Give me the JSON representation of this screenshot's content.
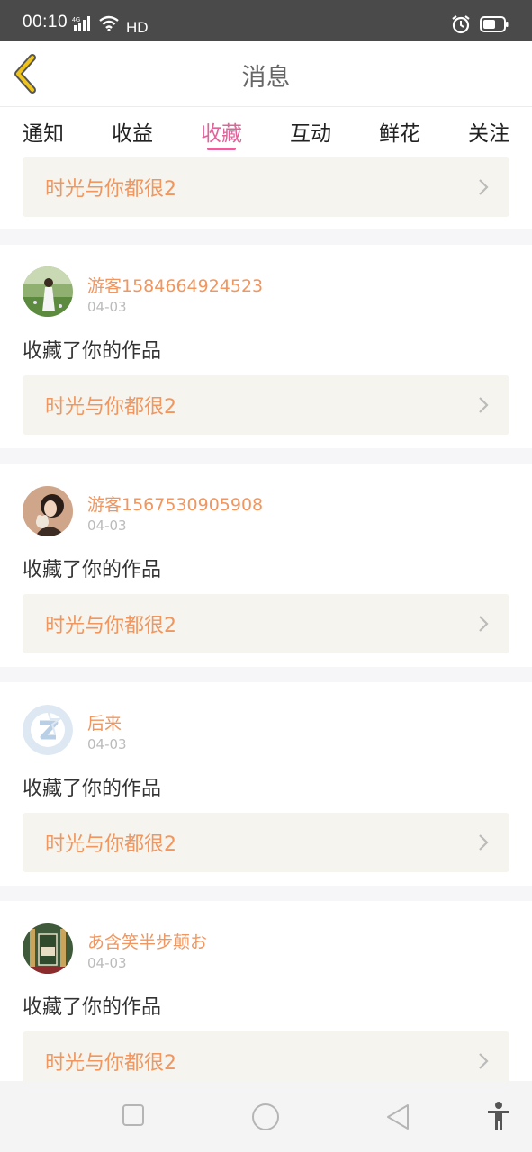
{
  "status": {
    "time": "00:10",
    "network": "4G",
    "hd": "HD",
    "bar_color": "#4a4a4a"
  },
  "header": {
    "title": "消息",
    "back_icon": "chevron-left-icon",
    "back_color": "#f0c419"
  },
  "tabs": [
    {
      "label": "通知",
      "active": false
    },
    {
      "label": "收益",
      "active": false
    },
    {
      "label": "收藏",
      "active": true
    },
    {
      "label": "互动",
      "active": false
    },
    {
      "label": "鲜花",
      "active": false
    },
    {
      "label": "关注",
      "active": false
    }
  ],
  "colors": {
    "accent_pink": "#e0649a",
    "accent_orange": "#f0965e",
    "link_bg": "#f5f4ee"
  },
  "feed": {
    "partial_top": {
      "work_title": "时光与你都很2"
    },
    "items": [
      {
        "user": "游客1584664924523",
        "date": "04-03",
        "action": "收藏了你的作品",
        "work_title": "时光与你都很2"
      },
      {
        "user": "游客1567530905908",
        "date": "04-03",
        "action": "收藏了你的作品",
        "work_title": "时光与你都很2"
      },
      {
        "user": "后来",
        "date": "04-03",
        "action": "收藏了你的作品",
        "work_title": "时光与你都很2"
      },
      {
        "user": "あ含笑半步颠お",
        "date": "04-03",
        "action": "收藏了你的作品",
        "work_title": "时光与你都很2"
      }
    ]
  },
  "nav": {
    "recents_icon": "square-icon",
    "home_icon": "circle-icon",
    "back_icon": "triangle-back-icon",
    "accessibility_icon": "accessibility-icon"
  }
}
